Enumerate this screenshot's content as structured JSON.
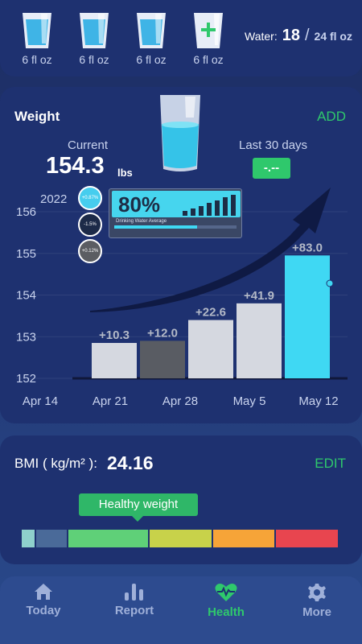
{
  "water": {
    "cups": [
      {
        "label": "6 fl oz",
        "state": "filled"
      },
      {
        "label": "6 fl oz",
        "state": "filled"
      },
      {
        "label": "6 fl oz",
        "state": "filled"
      },
      {
        "label": "6 fl oz",
        "state": "add"
      }
    ],
    "summary_label": "Water:",
    "count": "18",
    "slash": "/",
    "goal": "24 fl oz"
  },
  "weight": {
    "title": "Weight",
    "add_label": "ADD",
    "current_label": "Current",
    "current_value": "154.3",
    "current_unit": "lbs",
    "last30_label": "Last 30 days",
    "last30_value": "-.--",
    "year_label": "2022"
  },
  "promo": {
    "percent": "80%",
    "subtitle": "Drinking Water Average",
    "progress": 0.68,
    "dots": [
      "+0.87%",
      "-1.5%",
      "+0.12%"
    ]
  },
  "chart_data": {
    "type": "bar",
    "categories": [
      "Apr 14",
      "Apr 21",
      "Apr 28",
      "May 5",
      "May 12"
    ],
    "values": [
      null,
      152.85,
      152.9,
      153.4,
      153.8,
      154.95
    ],
    "bars": [
      {
        "x": "Apr 21",
        "value": 152.85,
        "label": "+10.3",
        "color": "#d5d8e0"
      },
      {
        "x": "Apr 28",
        "value": 152.9,
        "label": "+12.0",
        "color": "#595c63"
      },
      {
        "x": "Apr 28b",
        "value": 153.4,
        "label": "+22.6",
        "color": "#d5d8e0"
      },
      {
        "x": "May 5",
        "value": 153.8,
        "label": "+41.9",
        "color": "#d5d8e0"
      },
      {
        "x": "May 12",
        "value": 154.95,
        "label": "+83.0",
        "color": "#3fd8f3"
      }
    ],
    "yticks": [
      152,
      153,
      154,
      155,
      156
    ],
    "ylim": [
      152,
      156.3
    ]
  },
  "bmi": {
    "label": "BMI ( kg/m² ):",
    "value": "24.16",
    "edit_label": "EDIT",
    "tag": "Healthy weight",
    "segments": [
      {
        "color": "#8fd1cc",
        "width": 16
      },
      {
        "color": "#4a6a99",
        "width": 38
      },
      {
        "color": "#5fd078",
        "width": 99
      },
      {
        "color": "#c8d24a",
        "width": 77
      },
      {
        "color": "#f6a438",
        "width": 76
      },
      {
        "color": "#e8454f",
        "width": 77
      }
    ]
  },
  "nav": {
    "items": [
      {
        "label": "Today",
        "icon": "home-icon"
      },
      {
        "label": "Report",
        "icon": "bar-chart-icon"
      },
      {
        "label": "Health",
        "icon": "heart-pulse-icon"
      },
      {
        "label": "More",
        "icon": "gear-icon"
      }
    ],
    "active_index": 2,
    "accent": "#2fc86c"
  }
}
